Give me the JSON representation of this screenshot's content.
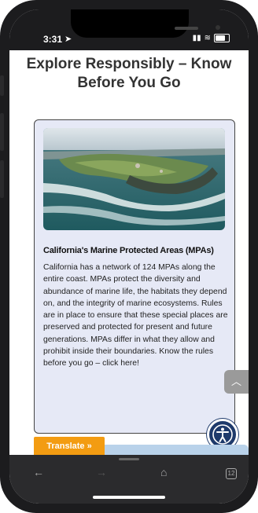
{
  "status": {
    "time": "3:31"
  },
  "page": {
    "title": "Explore Responsibly – Know Before You Go"
  },
  "card": {
    "title": "California's Marine Protected Areas (MPAs)",
    "body": "California has a network of 124 MPAs along the entire coast. MPAs protect the diversity and abundance of marine life, the habitats they depend on, and the integrity of marine ecosystems. Rules are in place to ensure that these special places are preserved and protected for present and future generations. MPAs differ in what they allow and prohibit inside their boundaries. Know the rules before you go – click here!",
    "image_alt": "coastline-photo"
  },
  "widgets": {
    "translate_label": "Translate »",
    "tabs_count": "12",
    "accessibility_icon": "accessibility-icon",
    "scroll_up_icon": "chevron-up-icon"
  },
  "colors": {
    "card_bg": "#e6e9f6",
    "translate_bg": "#f39c12",
    "access_bg": "#1e3a6b"
  }
}
